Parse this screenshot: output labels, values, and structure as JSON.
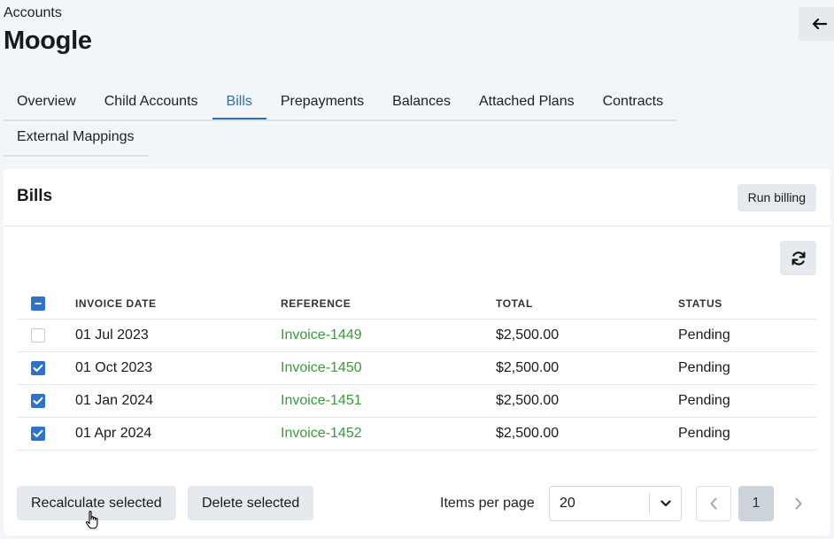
{
  "header": {
    "breadcrumb": "Accounts",
    "title": "Moogle"
  },
  "tabs": [
    {
      "label": "Overview"
    },
    {
      "label": "Child Accounts"
    },
    {
      "label": "Bills"
    },
    {
      "label": "Prepayments"
    },
    {
      "label": "Balances"
    },
    {
      "label": "Attached Plans"
    },
    {
      "label": "Contracts"
    },
    {
      "label": "External Mappings"
    }
  ],
  "active_tab": "Bills",
  "card": {
    "title": "Bills",
    "run_billing_label": "Run billing"
  },
  "table": {
    "headers": [
      "INVOICE DATE",
      "REFERENCE",
      "TOTAL",
      "STATUS"
    ],
    "select_all_state": "indeterminate",
    "rows": [
      {
        "checked": false,
        "date": "01 Jul 2023",
        "reference": "Invoice-1449",
        "total": "$2,500.00",
        "status": "Pending"
      },
      {
        "checked": true,
        "date": "01 Oct 2023",
        "reference": "Invoice-1450",
        "total": "$2,500.00",
        "status": "Pending"
      },
      {
        "checked": true,
        "date": "01 Jan 2024",
        "reference": "Invoice-1451",
        "total": "$2,500.00",
        "status": "Pending"
      },
      {
        "checked": true,
        "date": "01 Apr 2024",
        "reference": "Invoice-1452",
        "total": "$2,500.00",
        "status": "Pending"
      }
    ]
  },
  "footer": {
    "recalculate_label": "Recalculate selected",
    "delete_label": "Delete selected",
    "items_per_page_label": "Items per page",
    "items_per_page_value": "20",
    "current_page": "1"
  },
  "icons": {
    "back": "arrow-left-icon",
    "refresh": "refresh-icon",
    "select_chevron": "chevron-down-icon",
    "prev": "chevron-left-icon",
    "next": "chevron-right-icon",
    "cursor": "hand-pointer-icon"
  },
  "colors": {
    "accent": "#2c6fb3",
    "checkbox": "#2e73c6",
    "link": "#3a9b3a",
    "page_bg": "#f2f5f9"
  }
}
